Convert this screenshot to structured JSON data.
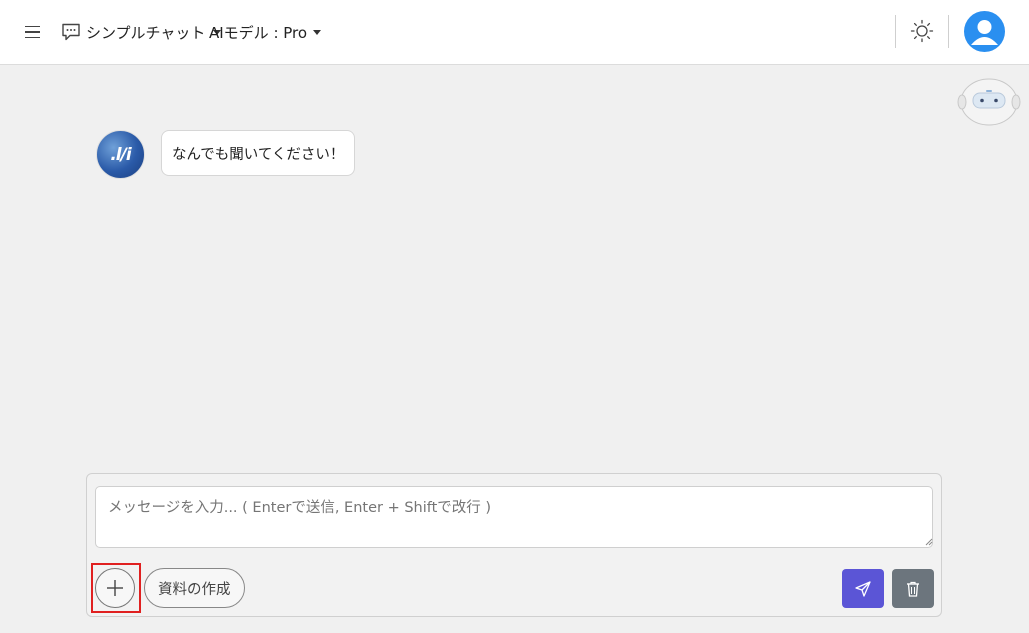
{
  "header": {
    "chat_mode_label": "シンプルチャット",
    "model_label": "AIモデル : Pro"
  },
  "icons": {
    "menu": "hamburger-menu-icon",
    "chat_mode": "chat-bubble-icon",
    "theme": "sun-icon",
    "user": "user-avatar-icon",
    "assistant_character": "robot-icon",
    "attach": "plus-icon",
    "send": "paper-plane-icon",
    "delete": "trash-icon"
  },
  "conversation": {
    "messages": [
      {
        "role": "assistant",
        "avatar_text": ".l/i",
        "text": "なんでも聞いてください！"
      }
    ]
  },
  "composer": {
    "placeholder": "メッセージを入力... ( Enterで送信, Enter + Shiftで改行 )",
    "value": "",
    "create_document_label": "資料の作成"
  },
  "colors": {
    "send_button": "#5b55d6",
    "delete_button": "#6c757d",
    "user_avatar": "#2a8ff0",
    "highlight_outline": "#e02020"
  }
}
